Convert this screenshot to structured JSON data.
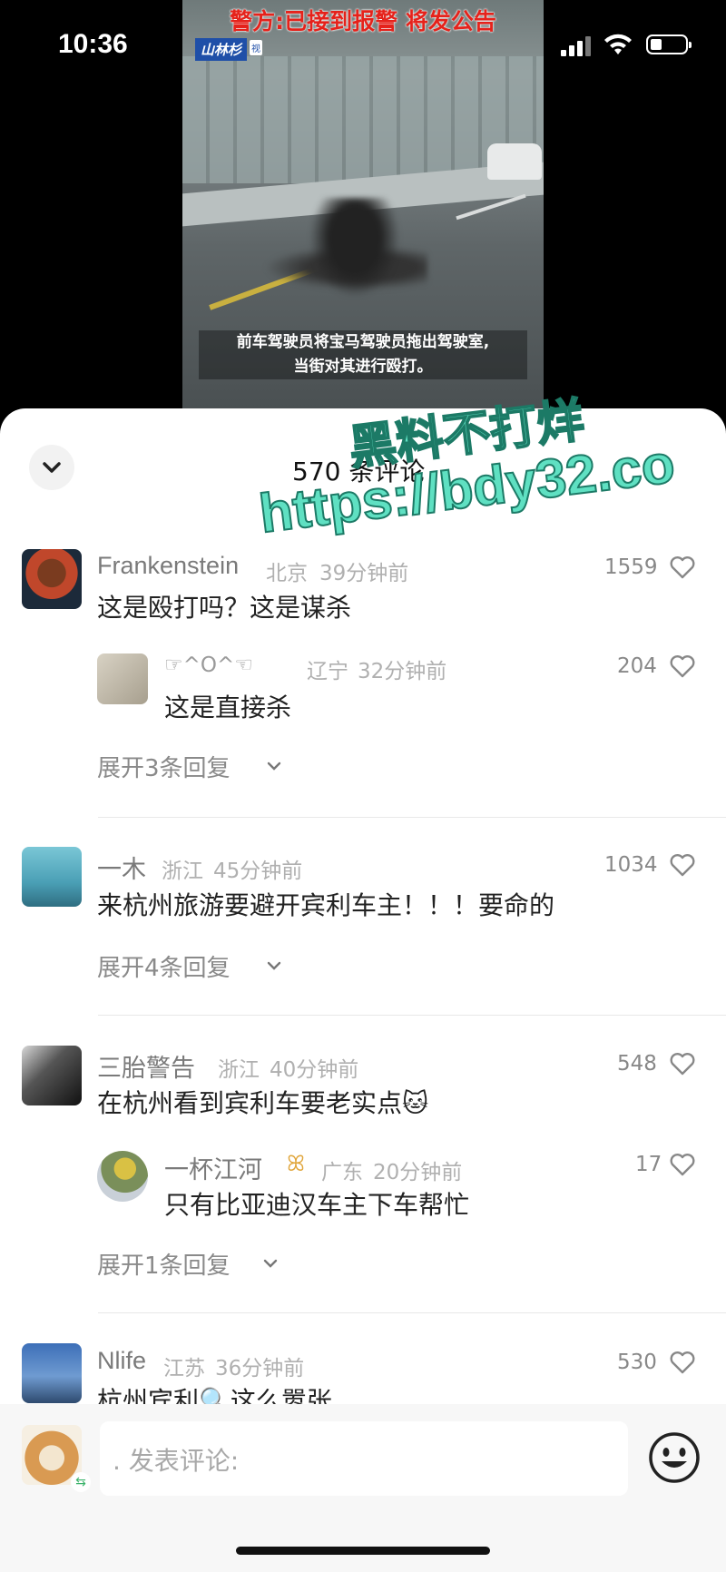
{
  "status_bar": {
    "time": "10:36"
  },
  "video": {
    "headline": "警方:已接到报警 将发公告",
    "logo": "&Lsquo;",
    "logo_text": "山林杉",
    "logo_tag": "视",
    "caption_line1": "前车驾驶员将宝马驾驶员拖出驾驶室,",
    "caption_line2": "当街对其进行殴打。"
  },
  "comments_header": {
    "count_label": "570 条评论"
  },
  "watermark": {
    "line1": "黑料不打烊",
    "line2": "https://bdy32.co"
  },
  "comments": [
    {
      "user": "Frankenstein",
      "location": "北京",
      "time": "39分钟前",
      "likes": "1559",
      "text": "这是殴打吗？这是谋杀",
      "reply": {
        "user": "☞^O^☜",
        "location": "辽宁",
        "time": "32分钟前",
        "likes": "204",
        "text": "这是直接杀"
      },
      "expand": "展开3条回复"
    },
    {
      "user": "一木",
      "location": "浙江",
      "time": "45分钟前",
      "likes": "1034",
      "text": "来杭州旅游要避开宾利车主！！！要命的",
      "expand": "展开4条回复"
    },
    {
      "user": "三胎警告",
      "location": "浙江",
      "time": "40分钟前",
      "likes": "548",
      "text": "在杭州看到宾利车要老实点",
      "emoji": "🐱",
      "reply": {
        "user": "一杯江河",
        "badge": "ꕤ",
        "location": "广东",
        "time": "20分钟前",
        "likes": "17",
        "text": "只有比亚迪汉车主下车帮忙"
      },
      "expand": "展开1条回复"
    },
    {
      "user": "Nlife",
      "location": "江苏",
      "time": "36分钟前",
      "likes": "530",
      "text": "杭州宾利🔍这么嚣张"
    }
  ],
  "composer": {
    "placeholder": ". 发表评论:"
  },
  "colors": {
    "sheet": "#ffffff",
    "watermark": "#5fe0c2",
    "headline": "#e5221b"
  }
}
